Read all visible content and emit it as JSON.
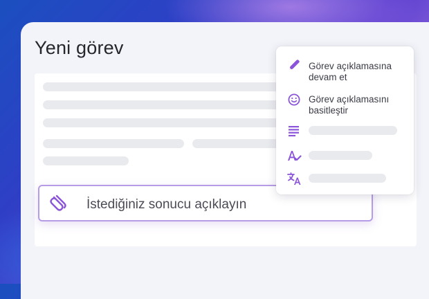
{
  "page": {
    "title": "Yeni görev"
  },
  "prompt": {
    "text": "İstediğiniz sonucu açıklayın",
    "icon": "spiral-icon"
  },
  "menu": {
    "items": [
      {
        "label": "Görev açıklamasına devam et",
        "icon": "pen-icon"
      },
      {
        "label": "Görev açıklamasını basitleştir",
        "icon": "smiley-icon"
      },
      {
        "label": "",
        "icon": "text-lines-icon"
      },
      {
        "label": "",
        "icon": "spell-check-icon"
      },
      {
        "label": "",
        "icon": "translate-icon"
      }
    ]
  },
  "colors": {
    "accent": "#8b55d9",
    "accent_border": "#b69be6",
    "skeleton": "#e9eaee",
    "panel": "#f3f4f9"
  }
}
